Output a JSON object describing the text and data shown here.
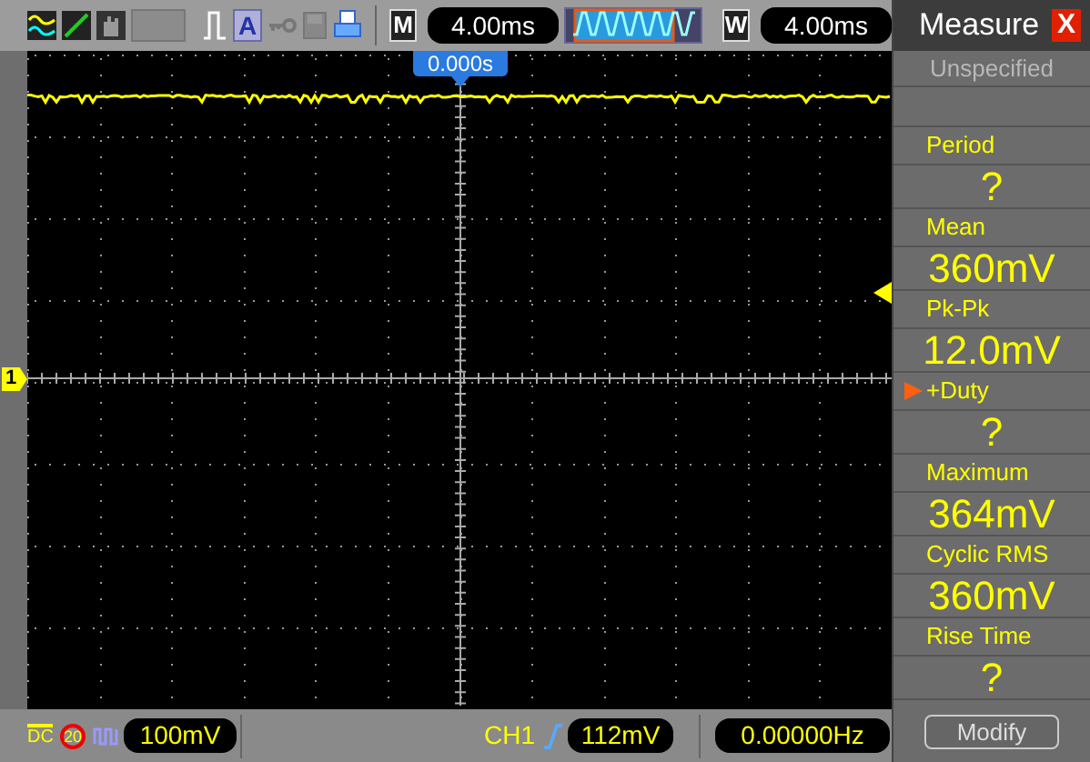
{
  "toolbar": {
    "auto_key": "A",
    "menu_key": "M",
    "timebase": "4.00ms",
    "window_key": "W",
    "window_timebase": "4.00ms"
  },
  "trigger_position": "0.000s",
  "channel_marker": "1",
  "measure_panel": {
    "title": "Measure",
    "close": "X",
    "subtitle": "Unspecified",
    "items": [
      {
        "label": "Period",
        "value": "?",
        "selected": false
      },
      {
        "label": "Mean",
        "value": "360mV",
        "selected": false
      },
      {
        "label": "Pk-Pk",
        "value": "12.0mV",
        "selected": false
      },
      {
        "label": "+Duty",
        "value": "?",
        "selected": true
      },
      {
        "label": "Maximum",
        "value": "364mV",
        "selected": false
      },
      {
        "label": "Cyclic RMS",
        "value": "360mV",
        "selected": false
      },
      {
        "label": "Rise Time",
        "value": "?",
        "selected": false
      }
    ],
    "button": "Modify"
  },
  "status_bar": {
    "coupling": "DC",
    "bandwidth_limit": "20",
    "channel_scale": "100mV",
    "trigger_source": "CH1",
    "trigger_level": "112mV",
    "frequency": "0.00000Hz"
  }
}
